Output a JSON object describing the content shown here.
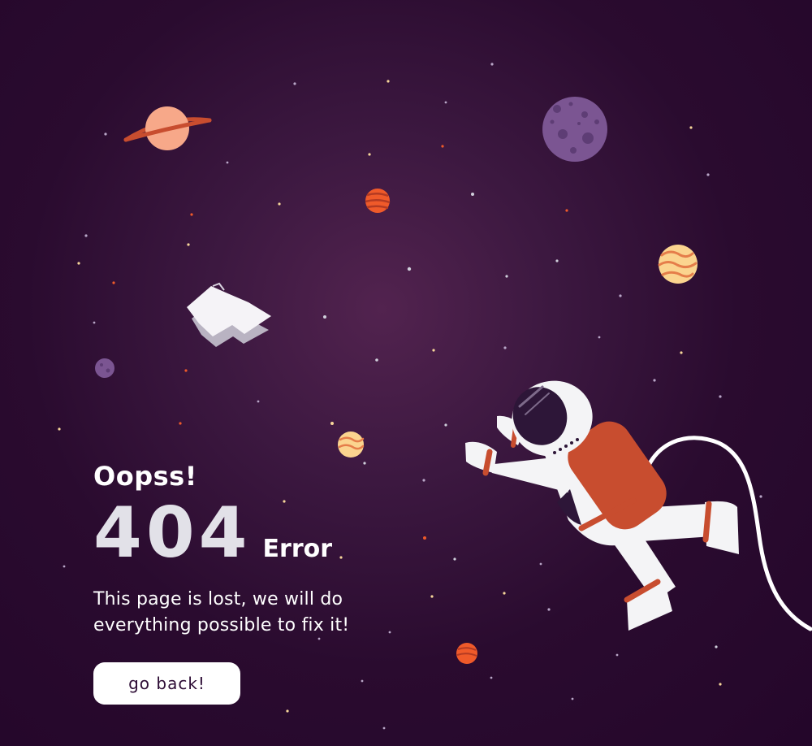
{
  "message": {
    "oops": "Oopss!",
    "code": "404",
    "error_word": "Error",
    "description": "This page is lost, we will do\neverything possible to fix it!"
  },
  "actions": {
    "back_label": "go back!"
  },
  "illustration": {
    "icons": [
      "ringed-planet-icon",
      "cratered-planet-icon",
      "striped-planet-icon",
      "small-planet-icon",
      "floating-paper-icon",
      "astronaut-icon",
      "tether-cable-icon",
      "star-icon"
    ]
  },
  "colors": {
    "background": "#2a0b2f",
    "button_background": "#ffffff",
    "button_text": "#2d0c35",
    "accent_orange": "#c84d2f",
    "planet_purple": "#7b5592"
  }
}
